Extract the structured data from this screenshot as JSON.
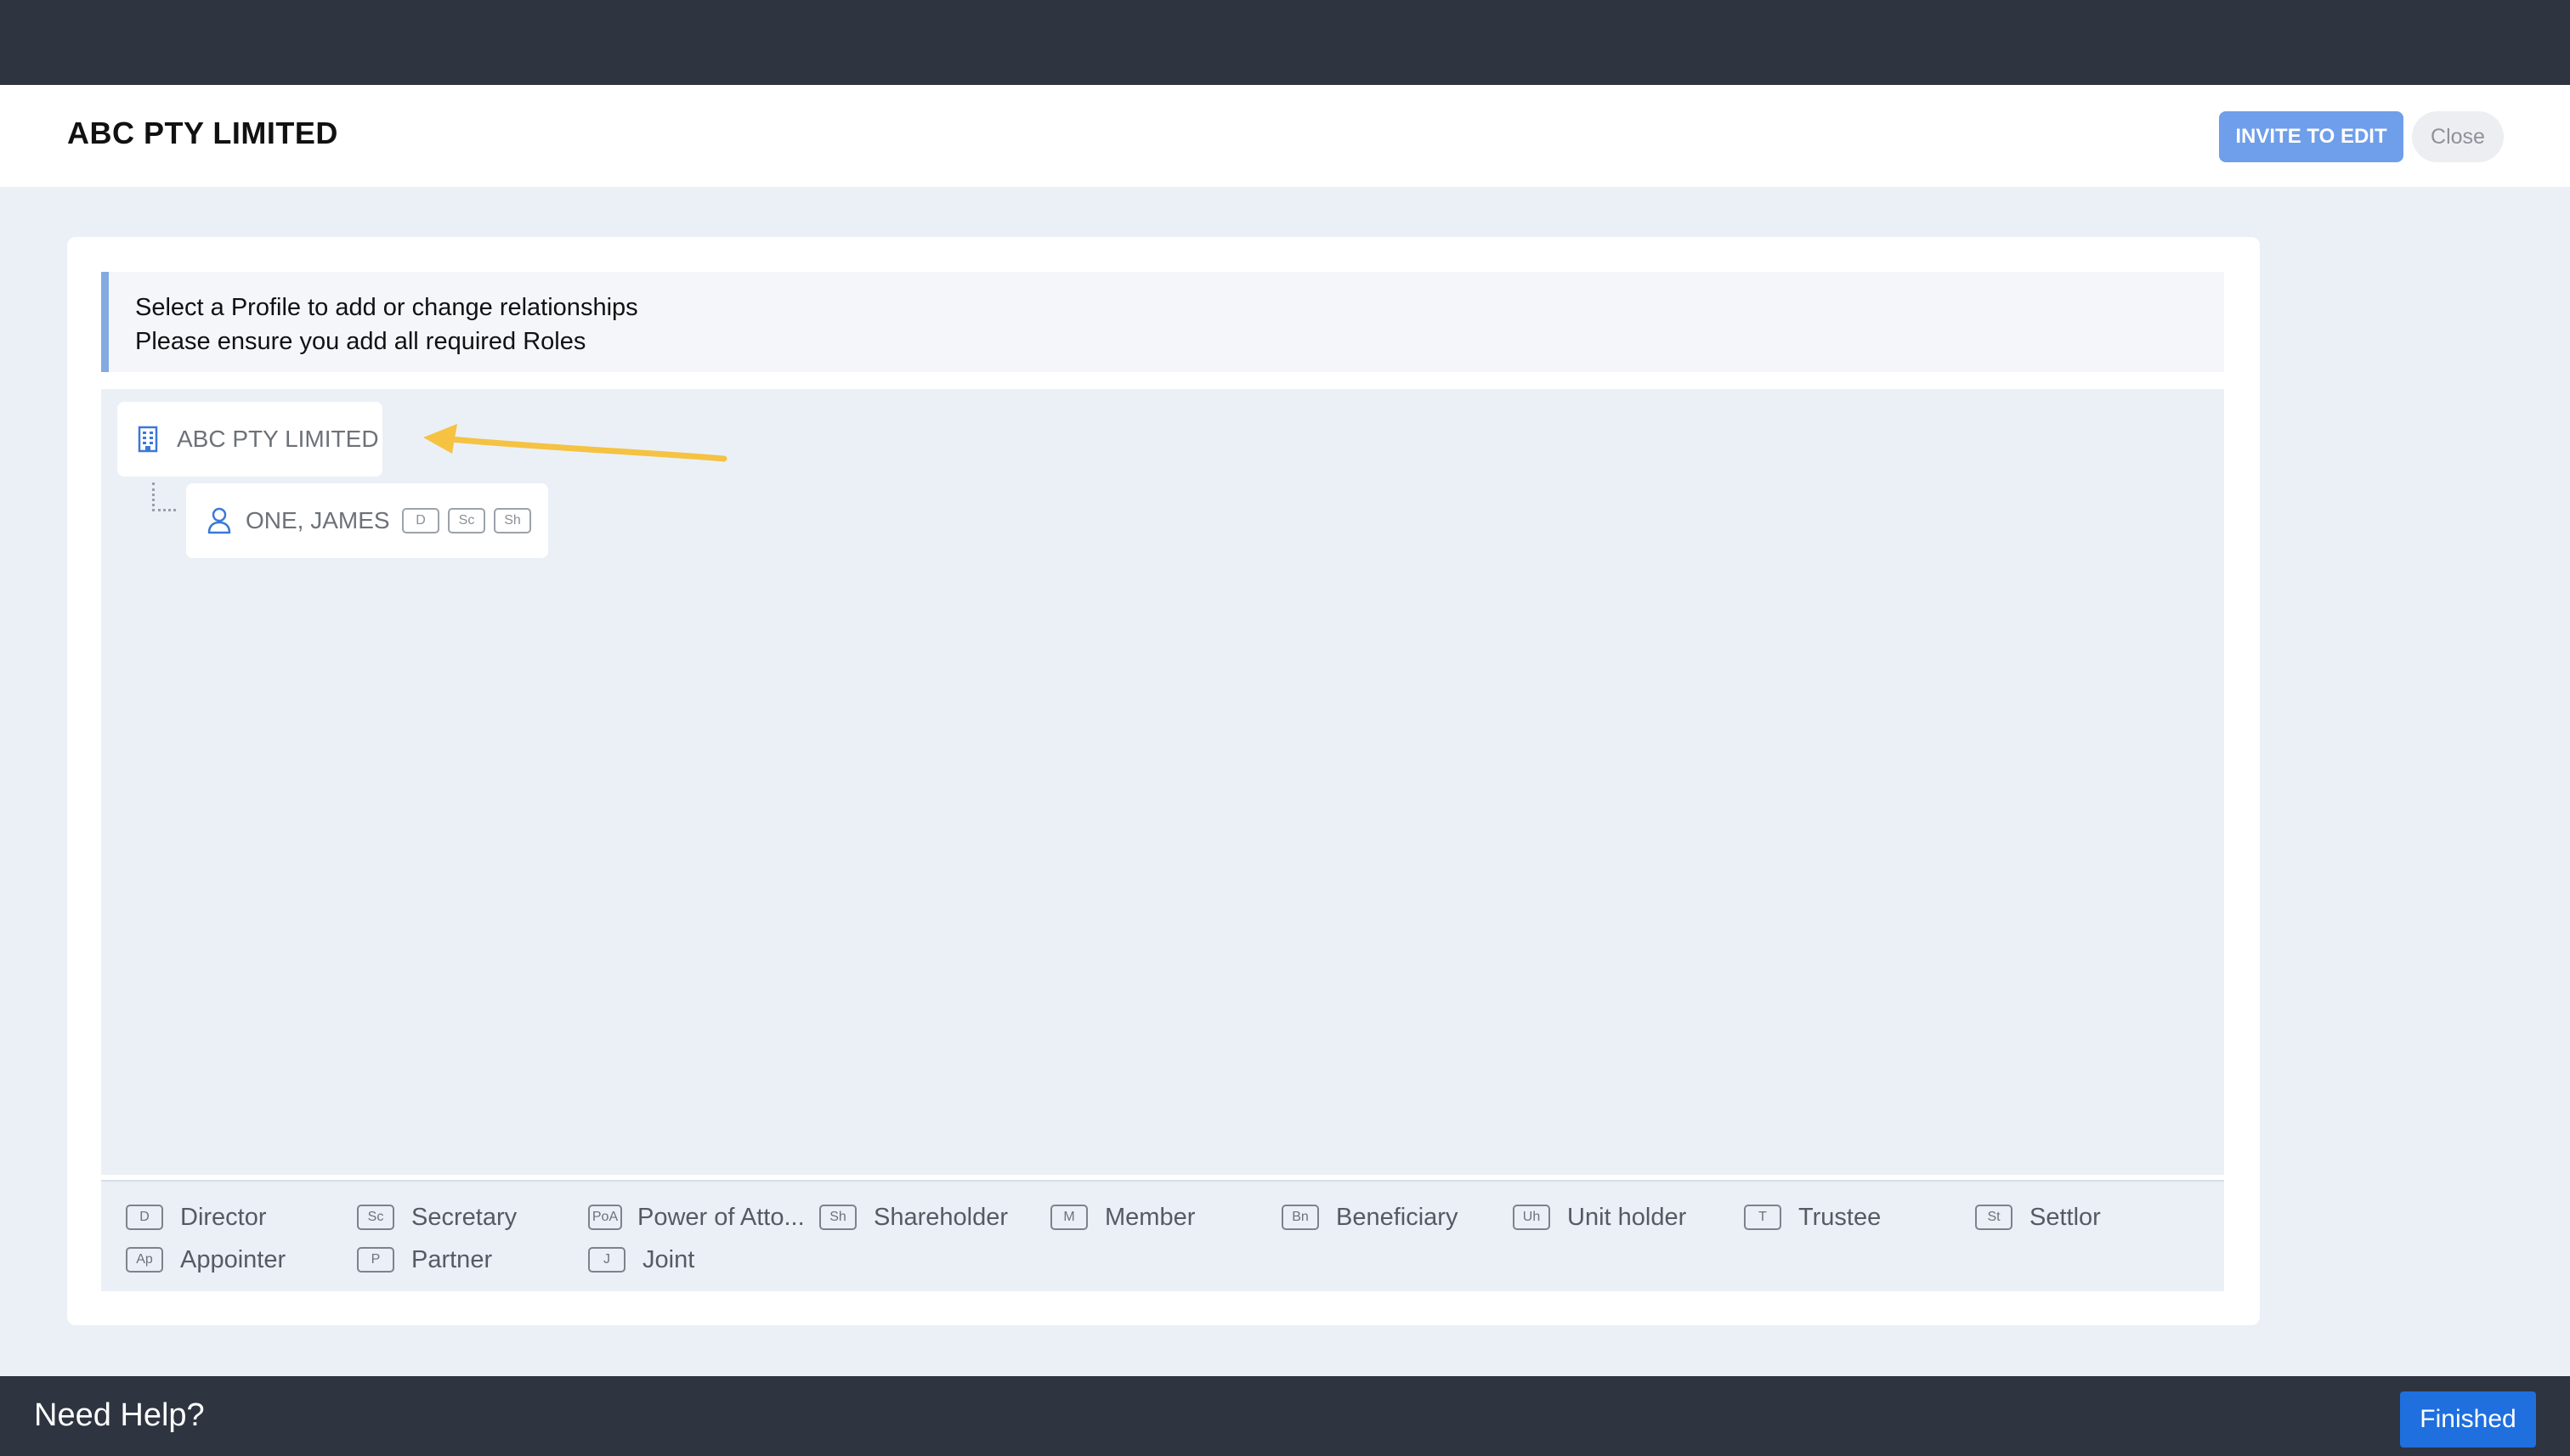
{
  "header": {
    "title": "ABC PTY LIMITED",
    "invite_label": "INVITE TO EDIT",
    "close_label": "Close"
  },
  "info": {
    "line1": "Select a Profile to add or change relationships",
    "line2": "Please ensure you add all required Roles"
  },
  "tree": {
    "root": {
      "label": "ABC PTY LIMITED",
      "icon": "building-icon"
    },
    "child": {
      "label": "ONE, JAMES",
      "icon": "person-icon",
      "roles": [
        "D",
        "Sc",
        "Sh"
      ]
    }
  },
  "legend": [
    {
      "code": "D",
      "label": "Director"
    },
    {
      "code": "Sc",
      "label": "Secretary"
    },
    {
      "code": "PoA",
      "label": "Power of Atto..."
    },
    {
      "code": "Sh",
      "label": "Shareholder"
    },
    {
      "code": "M",
      "label": "Member"
    },
    {
      "code": "Bn",
      "label": "Beneficiary"
    },
    {
      "code": "Uh",
      "label": "Unit holder"
    },
    {
      "code": "T",
      "label": "Trustee"
    },
    {
      "code": "St",
      "label": "Settlor"
    },
    {
      "code": "Ap",
      "label": "Appointer"
    },
    {
      "code": "P",
      "label": "Partner"
    },
    {
      "code": "J",
      "label": "Joint"
    }
  ],
  "footer": {
    "help_label": "Need Help?",
    "finished_label": "Finished"
  },
  "colors": {
    "topbar": "#2e3440",
    "accent": "#1f6fde",
    "invite": "#6f9eea",
    "annotation_arrow": "#f5c242"
  }
}
